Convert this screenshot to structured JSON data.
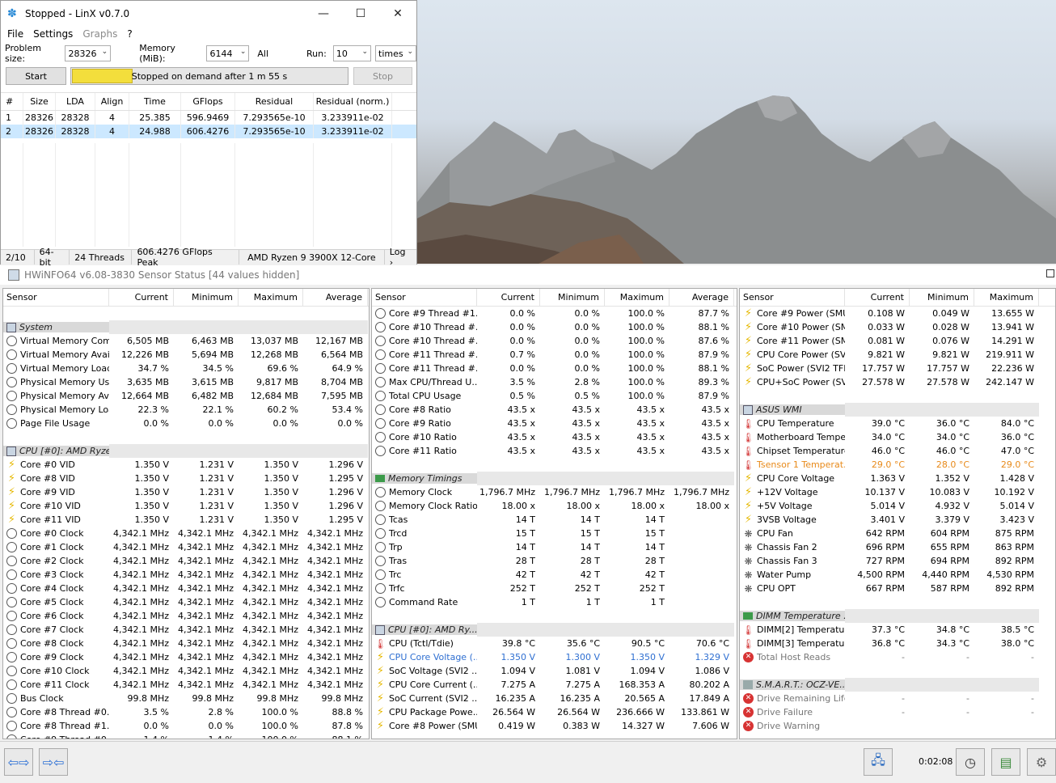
{
  "linx": {
    "title": "Stopped - LinX v0.7.0",
    "menu": [
      "File",
      "Settings",
      "Graphs",
      "?"
    ],
    "problem_size_label": "Problem size:",
    "problem_size": "28326",
    "memory_label": "Memory (MiB):",
    "memory": "6144",
    "all_label": "All",
    "run_label": "Run:",
    "run": "10",
    "run_unit": "times",
    "start_label": "Start",
    "progress_fraction": 0.22,
    "progress_text": "Stopped on demand after 1 m 55 s",
    "stop_label": "Stop",
    "columns": [
      "#",
      "Size",
      "LDA",
      "Align",
      "Time",
      "GFlops",
      "Residual",
      "Residual (norm.)"
    ],
    "rows": [
      [
        "1",
        "28326",
        "28328",
        "4",
        "25.385",
        "596.9469",
        "7.293565e-10",
        "3.233911e-02"
      ],
      [
        "2",
        "28326",
        "28328",
        "4",
        "24.988",
        "606.4276",
        "7.293565e-10",
        "3.233911e-02"
      ]
    ],
    "status": [
      "2/10",
      "64-bit",
      "24 Threads",
      "606.4276 GFlops Peak",
      "AMD Ryzen 9 3900X 12-Core",
      "Log ›"
    ]
  },
  "hwinfo": {
    "title": "HWiNFO64 v6.08-3830 Sensor Status [44 values hidden]",
    "columns": [
      "Sensor",
      "Current",
      "Minimum",
      "Maximum",
      "Average"
    ],
    "panel1": [
      {
        "t": "blank"
      },
      {
        "t": "group",
        "icon": "chip",
        "name": "System"
      },
      {
        "t": "row",
        "icon": "clock",
        "name": "Virtual Memory Com...",
        "v": [
          "6,505 MB",
          "6,463 MB",
          "13,037 MB",
          "12,167 MB"
        ]
      },
      {
        "t": "row",
        "icon": "clock",
        "name": "Virtual Memory Avai...",
        "v": [
          "12,226 MB",
          "5,694 MB",
          "12,268 MB",
          "6,564 MB"
        ]
      },
      {
        "t": "row",
        "icon": "clock",
        "name": "Virtual Memory Load",
        "v": [
          "34.7 %",
          "34.5 %",
          "69.6 %",
          "64.9 %"
        ]
      },
      {
        "t": "row",
        "icon": "clock",
        "name": "Physical Memory Used",
        "v": [
          "3,635 MB",
          "3,615 MB",
          "9,817 MB",
          "8,704 MB"
        ]
      },
      {
        "t": "row",
        "icon": "clock",
        "name": "Physical Memory Av...",
        "v": [
          "12,664 MB",
          "6,482 MB",
          "12,684 MB",
          "7,595 MB"
        ]
      },
      {
        "t": "row",
        "icon": "clock",
        "name": "Physical Memory Load",
        "v": [
          "22.3 %",
          "22.1 %",
          "60.2 %",
          "53.4 %"
        ]
      },
      {
        "t": "row",
        "icon": "clock",
        "name": "Page File Usage",
        "v": [
          "0.0 %",
          "0.0 %",
          "0.0 %",
          "0.0 %"
        ]
      },
      {
        "t": "blank"
      },
      {
        "t": "group",
        "icon": "chip",
        "name": "CPU [#0]: AMD Ryze"
      },
      {
        "t": "row",
        "icon": "bolt",
        "name": "Core #0 VID",
        "v": [
          "1.350 V",
          "1.231 V",
          "1.350 V",
          "1.296 V"
        ]
      },
      {
        "t": "row",
        "icon": "bolt",
        "name": "Core #8 VID",
        "v": [
          "1.350 V",
          "1.231 V",
          "1.350 V",
          "1.295 V"
        ]
      },
      {
        "t": "row",
        "icon": "bolt",
        "name": "Core #9 VID",
        "v": [
          "1.350 V",
          "1.231 V",
          "1.350 V",
          "1.296 V"
        ]
      },
      {
        "t": "row",
        "icon": "bolt",
        "name": "Core #10 VID",
        "v": [
          "1.350 V",
          "1.231 V",
          "1.350 V",
          "1.296 V"
        ]
      },
      {
        "t": "row",
        "icon": "bolt",
        "name": "Core #11 VID",
        "v": [
          "1.350 V",
          "1.231 V",
          "1.350 V",
          "1.295 V"
        ]
      },
      {
        "t": "row",
        "icon": "clock",
        "name": "Core #0 Clock",
        "v": [
          "4,342.1 MHz",
          "4,342.1 MHz",
          "4,342.1 MHz",
          "4,342.1 MHz"
        ]
      },
      {
        "t": "row",
        "icon": "clock",
        "name": "Core #1 Clock",
        "v": [
          "4,342.1 MHz",
          "4,342.1 MHz",
          "4,342.1 MHz",
          "4,342.1 MHz"
        ]
      },
      {
        "t": "row",
        "icon": "clock",
        "name": "Core #2 Clock",
        "v": [
          "4,342.1 MHz",
          "4,342.1 MHz",
          "4,342.1 MHz",
          "4,342.1 MHz"
        ]
      },
      {
        "t": "row",
        "icon": "clock",
        "name": "Core #3 Clock",
        "v": [
          "4,342.1 MHz",
          "4,342.1 MHz",
          "4,342.1 MHz",
          "4,342.1 MHz"
        ]
      },
      {
        "t": "row",
        "icon": "clock",
        "name": "Core #4 Clock",
        "v": [
          "4,342.1 MHz",
          "4,342.1 MHz",
          "4,342.1 MHz",
          "4,342.1 MHz"
        ]
      },
      {
        "t": "row",
        "icon": "clock",
        "name": "Core #5 Clock",
        "v": [
          "4,342.1 MHz",
          "4,342.1 MHz",
          "4,342.1 MHz",
          "4,342.1 MHz"
        ]
      },
      {
        "t": "row",
        "icon": "clock",
        "name": "Core #6 Clock",
        "v": [
          "4,342.1 MHz",
          "4,342.1 MHz",
          "4,342.1 MHz",
          "4,342.1 MHz"
        ]
      },
      {
        "t": "row",
        "icon": "clock",
        "name": "Core #7 Clock",
        "v": [
          "4,342.1 MHz",
          "4,342.1 MHz",
          "4,342.1 MHz",
          "4,342.1 MHz"
        ]
      },
      {
        "t": "row",
        "icon": "clock",
        "name": "Core #8 Clock",
        "v": [
          "4,342.1 MHz",
          "4,342.1 MHz",
          "4,342.1 MHz",
          "4,342.1 MHz"
        ]
      },
      {
        "t": "row",
        "icon": "clock",
        "name": "Core #9 Clock",
        "v": [
          "4,342.1 MHz",
          "4,342.1 MHz",
          "4,342.1 MHz",
          "4,342.1 MHz"
        ]
      },
      {
        "t": "row",
        "icon": "clock",
        "name": "Core #10 Clock",
        "v": [
          "4,342.1 MHz",
          "4,342.1 MHz",
          "4,342.1 MHz",
          "4,342.1 MHz"
        ]
      },
      {
        "t": "row",
        "icon": "clock",
        "name": "Core #11 Clock",
        "v": [
          "4,342.1 MHz",
          "4,342.1 MHz",
          "4,342.1 MHz",
          "4,342.1 MHz"
        ]
      },
      {
        "t": "row",
        "icon": "clock",
        "name": "Bus Clock",
        "v": [
          "99.8 MHz",
          "99.8 MHz",
          "99.8 MHz",
          "99.8 MHz"
        ]
      },
      {
        "t": "row",
        "icon": "clock",
        "name": "Core #8 Thread #0...",
        "v": [
          "3.5 %",
          "2.8 %",
          "100.0 %",
          "88.8 %"
        ]
      },
      {
        "t": "row",
        "icon": "clock",
        "name": "Core #8 Thread #1...",
        "v": [
          "0.0 %",
          "0.0 %",
          "100.0 %",
          "87.8 %"
        ]
      },
      {
        "t": "row",
        "icon": "clock",
        "name": "Core #9 Thread #0...",
        "v": [
          "1.4 %",
          "1.4 %",
          "100.0 %",
          "88.1 %"
        ]
      }
    ],
    "panel2": [
      {
        "t": "row",
        "icon": "clock",
        "name": "Core #9 Thread #1...",
        "v": [
          "0.0 %",
          "0.0 %",
          "100.0 %",
          "87.7 %"
        ]
      },
      {
        "t": "row",
        "icon": "clock",
        "name": "Core #10 Thread #...",
        "v": [
          "0.0 %",
          "0.0 %",
          "100.0 %",
          "88.1 %"
        ]
      },
      {
        "t": "row",
        "icon": "clock",
        "name": "Core #10 Thread #...",
        "v": [
          "0.0 %",
          "0.0 %",
          "100.0 %",
          "87.6 %"
        ]
      },
      {
        "t": "row",
        "icon": "clock",
        "name": "Core #11 Thread #...",
        "v": [
          "0.7 %",
          "0.0 %",
          "100.0 %",
          "87.9 %"
        ]
      },
      {
        "t": "row",
        "icon": "clock",
        "name": "Core #11 Thread #...",
        "v": [
          "0.0 %",
          "0.0 %",
          "100.0 %",
          "88.1 %"
        ]
      },
      {
        "t": "row",
        "icon": "clock",
        "name": "Max CPU/Thread U...",
        "v": [
          "3.5 %",
          "2.8 %",
          "100.0 %",
          "89.3 %"
        ]
      },
      {
        "t": "row",
        "icon": "clock",
        "name": "Total CPU Usage",
        "v": [
          "0.5 %",
          "0.5 %",
          "100.0 %",
          "87.9 %"
        ]
      },
      {
        "t": "row",
        "icon": "clock",
        "name": "Core #8 Ratio",
        "v": [
          "43.5 x",
          "43.5 x",
          "43.5 x",
          "43.5 x"
        ]
      },
      {
        "t": "row",
        "icon": "clock",
        "name": "Core #9 Ratio",
        "v": [
          "43.5 x",
          "43.5 x",
          "43.5 x",
          "43.5 x"
        ]
      },
      {
        "t": "row",
        "icon": "clock",
        "name": "Core #10 Ratio",
        "v": [
          "43.5 x",
          "43.5 x",
          "43.5 x",
          "43.5 x"
        ]
      },
      {
        "t": "row",
        "icon": "clock",
        "name": "Core #11 Ratio",
        "v": [
          "43.5 x",
          "43.5 x",
          "43.5 x",
          "43.5 x"
        ]
      },
      {
        "t": "blank"
      },
      {
        "t": "group",
        "icon": "mem",
        "name": "Memory Timings"
      },
      {
        "t": "row",
        "icon": "clock",
        "name": "Memory Clock",
        "v": [
          "1,796.7 MHz",
          "1,796.7 MHz",
          "1,796.7 MHz",
          "1,796.7 MHz"
        ]
      },
      {
        "t": "row",
        "icon": "clock",
        "name": "Memory Clock Ratio",
        "v": [
          "18.00 x",
          "18.00 x",
          "18.00 x",
          "18.00 x"
        ]
      },
      {
        "t": "row",
        "icon": "clock",
        "name": "Tcas",
        "v": [
          "14 T",
          "14 T",
          "14 T",
          ""
        ]
      },
      {
        "t": "row",
        "icon": "clock",
        "name": "Trcd",
        "v": [
          "15 T",
          "15 T",
          "15 T",
          ""
        ]
      },
      {
        "t": "row",
        "icon": "clock",
        "name": "Trp",
        "v": [
          "14 T",
          "14 T",
          "14 T",
          ""
        ]
      },
      {
        "t": "row",
        "icon": "clock",
        "name": "Tras",
        "v": [
          "28 T",
          "28 T",
          "28 T",
          ""
        ]
      },
      {
        "t": "row",
        "icon": "clock",
        "name": "Trc",
        "v": [
          "42 T",
          "42 T",
          "42 T",
          ""
        ]
      },
      {
        "t": "row",
        "icon": "clock",
        "name": "Trfc",
        "v": [
          "252 T",
          "252 T",
          "252 T",
          ""
        ]
      },
      {
        "t": "row",
        "icon": "clock",
        "name": "Command Rate",
        "v": [
          "1 T",
          "1 T",
          "1 T",
          ""
        ]
      },
      {
        "t": "blank"
      },
      {
        "t": "group",
        "icon": "chip",
        "name": "CPU [#0]: AMD Ry..."
      },
      {
        "t": "row",
        "icon": "therm",
        "name": "CPU (Tctl/Tdie)",
        "v": [
          "39.8 °C",
          "35.6 °C",
          "90.5 °C",
          "70.6 °C"
        ]
      },
      {
        "t": "row",
        "icon": "bolt",
        "name": "CPU Core Voltage (...",
        "v": [
          "1.350 V",
          "1.300 V",
          "1.350 V",
          "1.329 V"
        ],
        "style": "hl"
      },
      {
        "t": "row",
        "icon": "bolt",
        "name": "SoC Voltage (SVI2 ...",
        "v": [
          "1.094 V",
          "1.081 V",
          "1.094 V",
          "1.086 V"
        ]
      },
      {
        "t": "row",
        "icon": "bolt",
        "name": "CPU Core Current (...",
        "v": [
          "7.275 A",
          "7.275 A",
          "168.353 A",
          "80.202 A"
        ]
      },
      {
        "t": "row",
        "icon": "bolt",
        "name": "SoC Current (SVI2 ...",
        "v": [
          "16.235 A",
          "16.235 A",
          "20.565 A",
          "17.849 A"
        ]
      },
      {
        "t": "row",
        "icon": "bolt",
        "name": "CPU Package Powe...",
        "v": [
          "26.564 W",
          "26.564 W",
          "236.666 W",
          "133.861 W"
        ]
      },
      {
        "t": "row",
        "icon": "bolt",
        "name": "Core #8 Power (SMU)",
        "v": [
          "0.419 W",
          "0.383 W",
          "14.327 W",
          "7.606 W"
        ]
      }
    ],
    "panel3": [
      {
        "t": "row",
        "icon": "bolt",
        "name": "Core #9 Power (SMU)",
        "v": [
          "0.108 W",
          "0.049 W",
          "13.655 W"
        ]
      },
      {
        "t": "row",
        "icon": "bolt",
        "name": "Core #10 Power (SMU)",
        "v": [
          "0.033 W",
          "0.028 W",
          "13.941 W"
        ]
      },
      {
        "t": "row",
        "icon": "bolt",
        "name": "Core #11 Power (SMU)",
        "v": [
          "0.081 W",
          "0.076 W",
          "14.291 W"
        ]
      },
      {
        "t": "row",
        "icon": "bolt",
        "name": "CPU Core Power (SV...",
        "v": [
          "9.821 W",
          "9.821 W",
          "219.911 W"
        ]
      },
      {
        "t": "row",
        "icon": "bolt",
        "name": "SoC Power (SVI2 TFN)",
        "v": [
          "17.757 W",
          "17.757 W",
          "22.236 W"
        ]
      },
      {
        "t": "row",
        "icon": "bolt",
        "name": "CPU+SoC Power (SV...",
        "v": [
          "27.578 W",
          "27.578 W",
          "242.147 W"
        ]
      },
      {
        "t": "blank"
      },
      {
        "t": "group",
        "icon": "chip",
        "name": "ASUS WMI"
      },
      {
        "t": "row",
        "icon": "therm",
        "name": "CPU Temperature",
        "v": [
          "39.0 °C",
          "36.0 °C",
          "84.0 °C"
        ]
      },
      {
        "t": "row",
        "icon": "therm",
        "name": "Motherboard Tempe...",
        "v": [
          "34.0 °C",
          "34.0 °C",
          "36.0 °C"
        ]
      },
      {
        "t": "row",
        "icon": "therm",
        "name": "Chipset Temperature",
        "v": [
          "46.0 °C",
          "46.0 °C",
          "47.0 °C"
        ]
      },
      {
        "t": "row",
        "icon": "therm",
        "name": "Tsensor 1 Temperat...",
        "v": [
          "29.0 °C",
          "28.0 °C",
          "29.0 °C"
        ],
        "style": "warn"
      },
      {
        "t": "row",
        "icon": "bolt",
        "name": "CPU Core Voltage",
        "v": [
          "1.363 V",
          "1.352 V",
          "1.428 V"
        ]
      },
      {
        "t": "row",
        "icon": "bolt",
        "name": "+12V Voltage",
        "v": [
          "10.137 V",
          "10.083 V",
          "10.192 V"
        ]
      },
      {
        "t": "row",
        "icon": "bolt",
        "name": "+5V Voltage",
        "v": [
          "5.014 V",
          "4.932 V",
          "5.014 V"
        ]
      },
      {
        "t": "row",
        "icon": "bolt",
        "name": "3VSB Voltage",
        "v": [
          "3.401 V",
          "3.379 V",
          "3.423 V"
        ]
      },
      {
        "t": "row",
        "icon": "fan",
        "name": "CPU Fan",
        "v": [
          "642 RPM",
          "604 RPM",
          "875 RPM"
        ]
      },
      {
        "t": "row",
        "icon": "fan",
        "name": "Chassis Fan 2",
        "v": [
          "696 RPM",
          "655 RPM",
          "863 RPM"
        ]
      },
      {
        "t": "row",
        "icon": "fan",
        "name": "Chassis Fan 3",
        "v": [
          "727 RPM",
          "694 RPM",
          "892 RPM"
        ]
      },
      {
        "t": "row",
        "icon": "fan",
        "name": "Water Pump",
        "v": [
          "4,500 RPM",
          "4,440 RPM",
          "4,530 RPM"
        ]
      },
      {
        "t": "row",
        "icon": "fan",
        "name": "CPU OPT",
        "v": [
          "667 RPM",
          "587 RPM",
          "892 RPM"
        ]
      },
      {
        "t": "blank"
      },
      {
        "t": "group",
        "icon": "mem",
        "name": "DIMM Temperature ..."
      },
      {
        "t": "row",
        "icon": "therm",
        "name": "DIMM[2] Temperature",
        "v": [
          "37.3 °C",
          "34.8 °C",
          "38.5 °C"
        ]
      },
      {
        "t": "row",
        "icon": "therm",
        "name": "DIMM[3] Temperature",
        "v": [
          "36.8 °C",
          "34.3 °C",
          "38.0 °C"
        ]
      },
      {
        "t": "row",
        "icon": "err",
        "name": "Total Host Reads",
        "v": [
          "-",
          "-",
          "-"
        ],
        "style": "dim"
      },
      {
        "t": "blank"
      },
      {
        "t": "group",
        "icon": "disk",
        "name": "S.M.A.R.T.: OCZ-VE..."
      },
      {
        "t": "row",
        "icon": "err",
        "name": "Drive Remaining Life",
        "v": [
          "-",
          "-",
          "-"
        ],
        "style": "dim"
      },
      {
        "t": "row",
        "icon": "err",
        "name": "Drive Failure",
        "v": [
          "-",
          "-",
          "-"
        ],
        "style": "dim"
      },
      {
        "t": "row",
        "icon": "err",
        "name": "Drive Warning",
        "v": [
          "",
          "",
          ""
        ],
        "style": "dim"
      }
    ],
    "elapsed": "0:02:08"
  },
  "colors": {
    "progress_fill": "#f3de3c",
    "selected_row": "#cce8ff",
    "highlight_blue": "#2f6fd1",
    "warning_orange": "#e88a1a"
  }
}
